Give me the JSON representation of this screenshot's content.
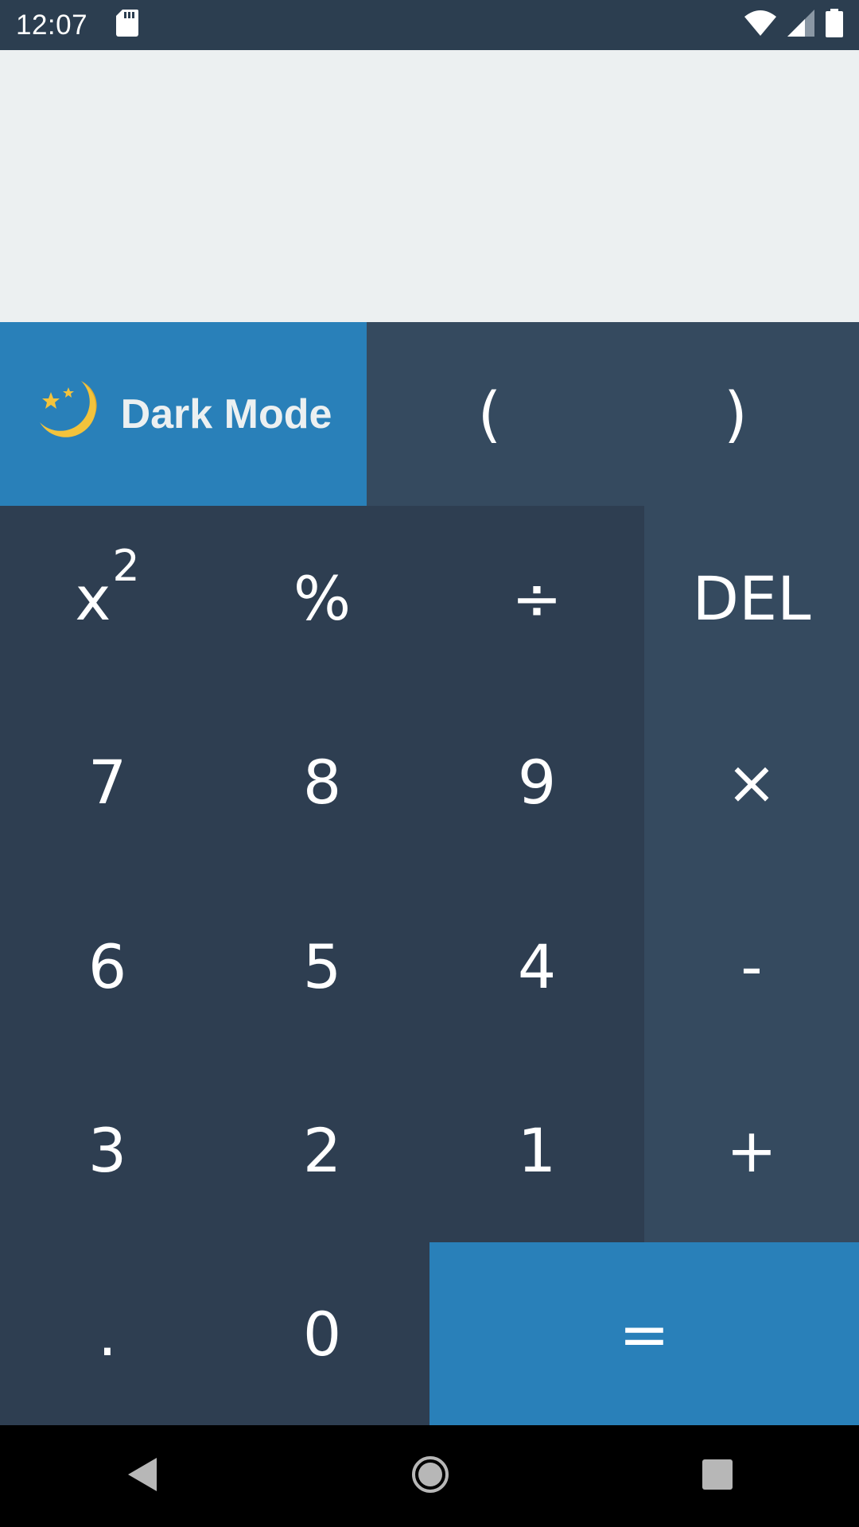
{
  "status": {
    "time": "12:07",
    "icons": [
      "sd-card-icon",
      "wifi-icon",
      "signal-icon",
      "battery-icon"
    ]
  },
  "display": {
    "expression": ""
  },
  "colors": {
    "display_bg": "#ecf0f1",
    "digit_key_bg": "#2e3e51",
    "operator_key_bg": "#354a5f",
    "accent": "#2980b9",
    "status_bar": "#2c3e50"
  },
  "toggle": {
    "label": "Dark Mode",
    "icon": "moon-stars-icon"
  },
  "keys": {
    "open_paren": "(",
    "close_paren": ")",
    "square_base": "x",
    "square_exp": "2",
    "percent": "%",
    "divide": "÷",
    "delete": "DEL",
    "seven": "7",
    "eight": "8",
    "nine": "9",
    "multiply": "×",
    "six": "6",
    "five": "5",
    "four": "4",
    "minus": "-",
    "three": "3",
    "two": "2",
    "one": "1",
    "plus": "+",
    "dot": ".",
    "zero": "0",
    "equals": "="
  },
  "nav": {
    "icons": [
      "back-icon",
      "home-icon",
      "recents-icon"
    ]
  }
}
